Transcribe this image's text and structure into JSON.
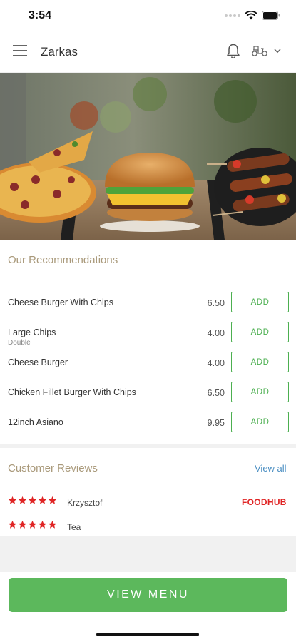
{
  "status_bar": {
    "time": "3:54"
  },
  "header": {
    "store_name": "Zarkas",
    "icons": [
      "menu-icon",
      "bell-icon",
      "scooter-icon",
      "chevron-down-icon"
    ]
  },
  "hero": {
    "icons": [
      "pizza-illustration",
      "burger-illustration",
      "kebab-illustration"
    ]
  },
  "recommendations": {
    "title": "Our Recommendations",
    "items": [
      {
        "name": "Cheese Burger With Chips",
        "subtitle": "",
        "price": "6.50",
        "button": "ADD"
      },
      {
        "name": "Large Chips",
        "subtitle": "Double",
        "price": "4.00",
        "button": "ADD"
      },
      {
        "name": "Cheese Burger",
        "subtitle": "",
        "price": "4.00",
        "button": "ADD"
      },
      {
        "name": "Chicken Fillet Burger With Chips",
        "subtitle": "",
        "price": "6.50",
        "button": "ADD"
      },
      {
        "name": "12inch Asiano",
        "subtitle": "",
        "price": "9.95",
        "button": "ADD"
      }
    ]
  },
  "reviews": {
    "title": "Customer Reviews",
    "view_all": "View all",
    "items": [
      {
        "reviewer": "Krzysztof",
        "rating": 5,
        "source": "FOODHUB"
      },
      {
        "reviewer": "Tea",
        "rating": 5
      }
    ]
  },
  "footer": {
    "view_menu": "VIEW MENU"
  },
  "colors": {
    "accent_green": "#5cb85c",
    "section_title": "#a9997a",
    "link_blue": "#4a8ec2",
    "star_red": "#e02424"
  }
}
